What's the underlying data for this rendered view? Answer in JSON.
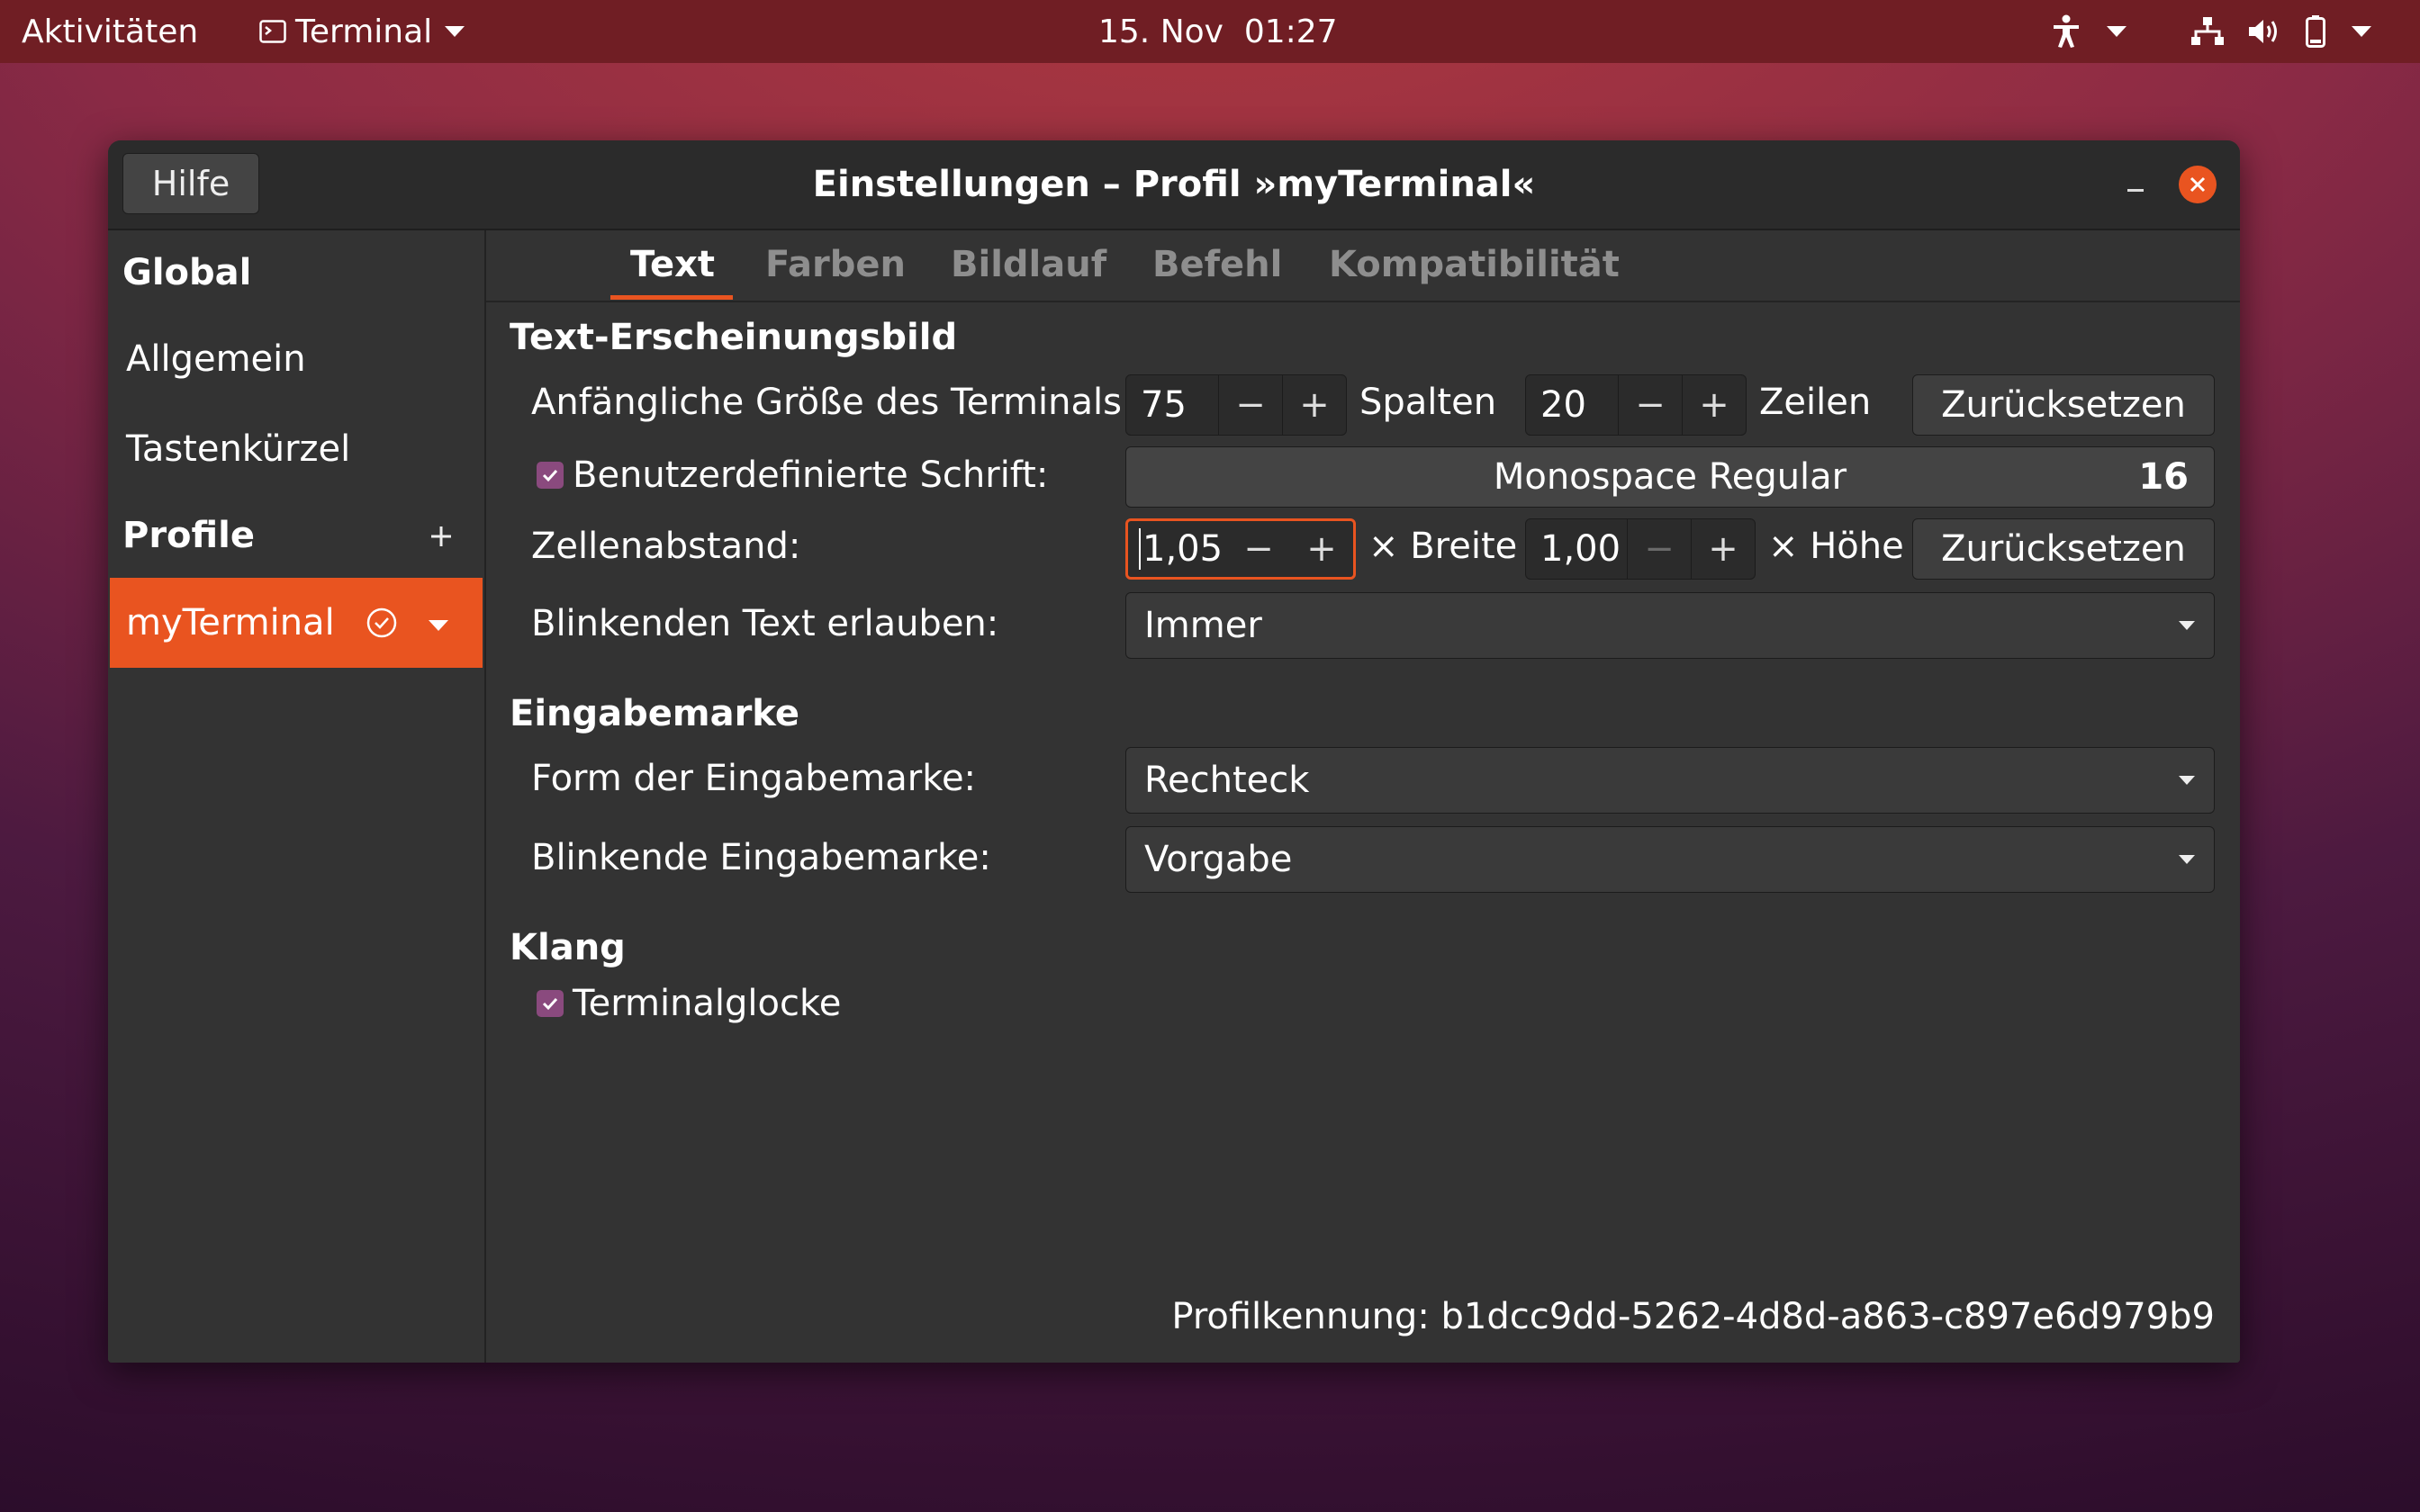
{
  "topbar": {
    "activities": "Aktivitäten",
    "app_name": "Terminal",
    "datetime": "15. Nov  01:27"
  },
  "window": {
    "title": "Einstellungen – Profil »myTerminal«",
    "help_label": "Hilfe"
  },
  "sidebar": {
    "global_heading": "Global",
    "items": [
      "Allgemein",
      "Tastenkürzel"
    ],
    "profiles_heading": "Profile",
    "active_profile": "myTerminal"
  },
  "tabs": [
    "Text",
    "Farben",
    "Bildlauf",
    "Befehl",
    "Kompatibilität"
  ],
  "text_appearance": {
    "heading": "Text-Erscheinungsbild",
    "size_label": "Anfängliche Größe des Terminals:",
    "columns_value": "75",
    "columns_unit": "Spalten",
    "rows_value": "20",
    "rows_unit": "Zeilen",
    "reset_label": "Zurücksetzen",
    "custom_font_label": "Benutzerdefinierte Schrift:",
    "font_name": "Monospace Regular",
    "font_size": "16",
    "cell_spacing_label": "Zellenabstand:",
    "width_value": "1,05",
    "width_unit": "× Breite",
    "height_value": "1,00",
    "height_unit": "× Höhe",
    "reset_label_2": "Zurücksetzen",
    "blink_text_label": "Blinkenden Text erlauben:",
    "blink_text_value": "Immer"
  },
  "cursor": {
    "heading": "Eingabemarke",
    "shape_label": "Form der Eingabemarke:",
    "shape_value": "Rechteck",
    "blink_label": "Blinkende Eingabemarke:",
    "blink_value": "Vorgabe"
  },
  "sound": {
    "heading": "Klang",
    "bell_label": "Terminalglocke"
  },
  "profile_id": "Profilkennung: b1dcc9dd-5262-4d8d-a863-c897e6d979b9",
  "colors": {
    "accent": "#e95420",
    "checkbox": "#8a4a7e",
    "window_bg": "#333333",
    "topbar_bg": "#701e24"
  },
  "icons": {
    "terminal": "terminal-icon",
    "accessibility": "accessibility-icon",
    "network": "network-icon",
    "volume": "volume-icon",
    "battery": "battery-icon"
  }
}
